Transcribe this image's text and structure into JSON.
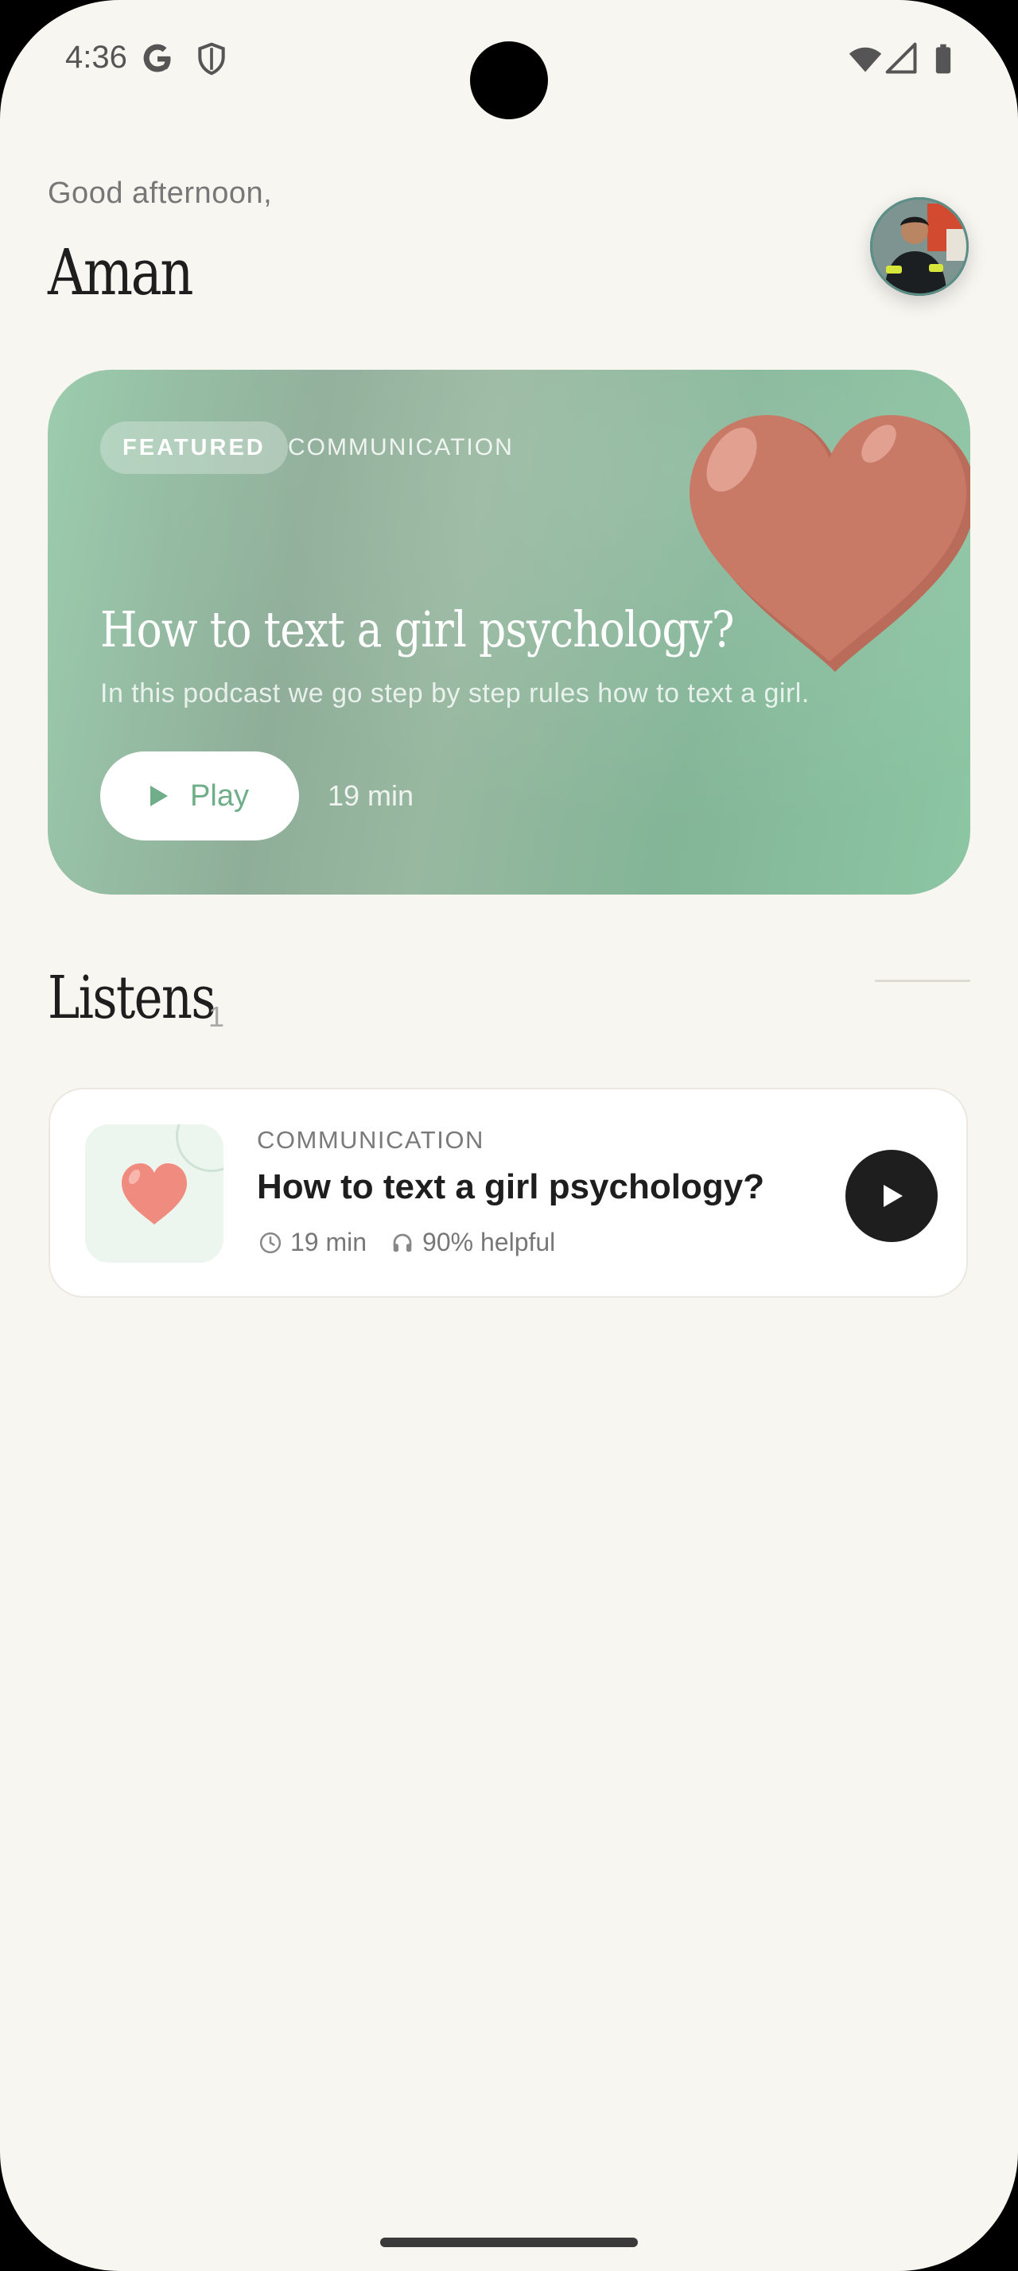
{
  "status_bar": {
    "time": "4:36",
    "icons": [
      "google-icon",
      "shield-icon",
      "wifi-icon",
      "signal-icon",
      "battery-icon"
    ]
  },
  "header": {
    "greeting": "Good afternoon,",
    "username": "Aman"
  },
  "featured": {
    "badge": "FEATURED",
    "category": "COMMUNICATION",
    "title": "How to text a girl psychology?",
    "description": "In this podcast we go step by step rules how to text a girl.",
    "play_label": "Play",
    "duration": "19 min",
    "colors": {
      "gradient_start": "#9cccae",
      "gradient_end": "#8cc6a3",
      "heart": "#c97a66",
      "accent": "#6fae88"
    }
  },
  "listens": {
    "title": "Listens",
    "count": "1",
    "items": [
      {
        "category": "COMMUNICATION",
        "title": "How to text a girl psychology?",
        "duration": "19 min",
        "helpful": "90% helpful",
        "thumb_icon": "heart-icon"
      }
    ]
  }
}
